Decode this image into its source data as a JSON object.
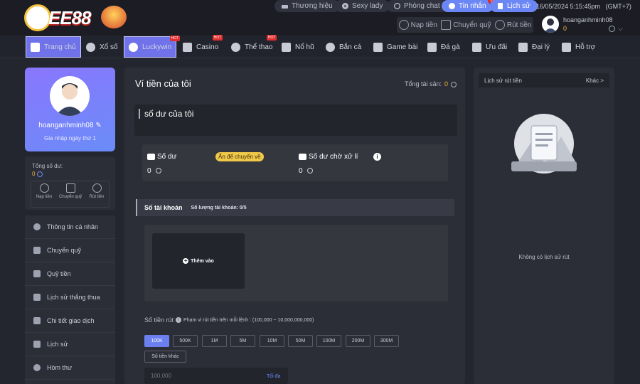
{
  "brand": {
    "logo_text": "EE88"
  },
  "top": {
    "pills": [
      {
        "label": "Thương hiệu",
        "icon": "car-icon"
      },
      {
        "label": "Sexy lady",
        "icon": "play-icon"
      },
      {
        "label": "Phòng chat",
        "icon": "chat-icon"
      },
      {
        "label": "Tin nhắn",
        "icon": "message-icon",
        "badge": "10"
      },
      {
        "label": "Lịch sử",
        "icon": "history-icon"
      }
    ],
    "datetime": "16/05/2024 5:15:45pm",
    "timezone": "(GMT+7)",
    "actions": [
      {
        "label": "Nạp tiền",
        "icon": "deposit-icon"
      },
      {
        "label": "Chuyển quỹ",
        "icon": "wallet-icon"
      },
      {
        "label": "Rút tiền",
        "icon": "withdraw-icon"
      }
    ],
    "username": "hoanganhminh08",
    "balance": "0"
  },
  "nav": [
    {
      "label": "Trang chủ",
      "icon": "home-icon",
      "active": true
    },
    {
      "label": "Xổ số",
      "icon": "lottery-icon"
    },
    {
      "label": "Luckywin",
      "icon": "luckywin-icon",
      "hot": true,
      "active": true
    },
    {
      "label": "Casino",
      "icon": "casino-icon",
      "hot": true
    },
    {
      "label": "Thể thao",
      "icon": "sport-icon",
      "hot": true
    },
    {
      "label": "Nổ hũ",
      "icon": "slot-icon"
    },
    {
      "label": "Bắn cá",
      "icon": "fish-icon"
    },
    {
      "label": "Game bài",
      "icon": "cards-icon"
    },
    {
      "label": "Đá gà",
      "icon": "rooster-icon"
    },
    {
      "label": "Ưu đãi",
      "icon": "gift-icon"
    },
    {
      "label": "Đại lý",
      "icon": "agent-icon"
    },
    {
      "label": "Hỗ trợ",
      "icon": "support-icon"
    }
  ],
  "hot_label": "HOT",
  "profile": {
    "username": "hoanganhminh08",
    "joined": "Gia nhập ngày thứ 1"
  },
  "balance_box": {
    "label": "Tổng số dư:",
    "value": "0",
    "actions": [
      {
        "label": "Nạp tiền",
        "icon": "deposit-icon"
      },
      {
        "label": "Chuyển quỹ",
        "icon": "wallet-icon"
      },
      {
        "label": "Rút tiền",
        "icon": "withdraw-icon"
      }
    ]
  },
  "side_menu": [
    {
      "label": "Thông tin cá nhân",
      "icon": "user-icon"
    },
    {
      "label": "Chuyển quỹ",
      "icon": "wallet-icon"
    },
    {
      "label": "Quỹ tiền",
      "icon": "fund-icon"
    },
    {
      "label": "Lịch sử thắng thua",
      "icon": "win-loss-icon"
    },
    {
      "label": "Chi tiết giao dịch",
      "icon": "transaction-icon"
    },
    {
      "label": "Lịch sử",
      "icon": "history-icon"
    },
    {
      "label": "Hòm thư",
      "icon": "mailbox-icon"
    }
  ],
  "main": {
    "title": "Ví tiền của tôi",
    "total_label": "Tổng tài sản:",
    "total_value": "0",
    "balance_header": "số dư của tôi",
    "balance_label": "Số dư",
    "hide_label": "Ấn để chuyển về",
    "balance_value": "0",
    "pending_label": "Số dư chờ xử lí",
    "pending_value": "0",
    "info_glyph": "i",
    "accounts_label": "Số tài khoản",
    "accounts_count": "Số lượng tài khoản:  0/5",
    "add_label": "Thêm vào",
    "add_glyph": "+",
    "amount_label": "Số tiền rút",
    "amount_info_glyph": "i",
    "amount_range": "Phạm vi rút tiền trên mỗi lệnh : (100,000 ~ 10,000,000,000)",
    "chips": [
      "100K",
      "500K",
      "1M",
      "5M",
      "10M",
      "50M",
      "100M",
      "200M",
      "300M"
    ],
    "other_chip": "Số tiền khác",
    "amount_placeholder": "100,000",
    "max_label": "Tối đa"
  },
  "right": {
    "title": "Lịch sử rút tiền",
    "more": "Khác >",
    "empty": "Không có lịch sử rút"
  },
  "colors": {
    "accent": "#6b7ff0",
    "gold": "#f1b43a",
    "bg": "#24262f",
    "panel": "#2c2e37"
  }
}
